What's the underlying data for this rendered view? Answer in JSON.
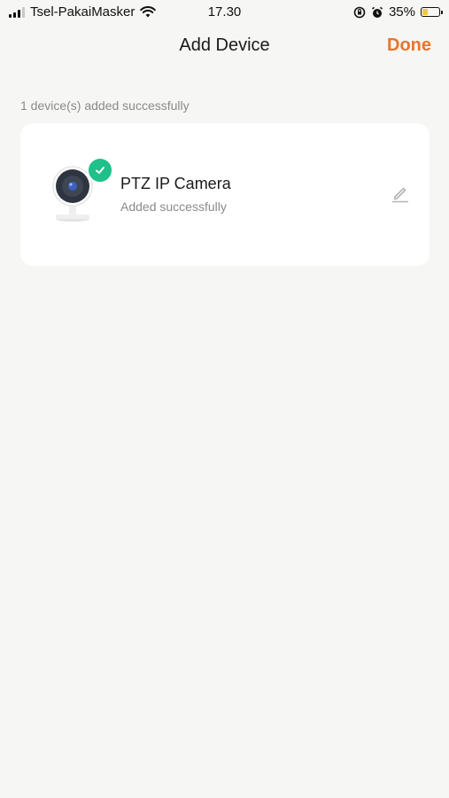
{
  "status_bar": {
    "carrier": "Tsel-PakaiMasker",
    "time": "17.30",
    "battery_percent": "35%",
    "battery_level": 0.35,
    "battery_color": "#f2c84b",
    "icons": [
      "signal-icon",
      "wifi-icon",
      "orientation-lock-icon",
      "alarm-icon",
      "battery-icon"
    ]
  },
  "nav": {
    "title": "Add Device",
    "done_label": "Done",
    "accent_color": "#e8742a"
  },
  "section_caption": "1 device(s) added successfully",
  "device": {
    "name": "PTZ IP Camera",
    "status": "Added successfully",
    "badge_color": "#1fc08a",
    "icons": [
      "camera-icon",
      "check-icon",
      "edit-icon"
    ]
  }
}
